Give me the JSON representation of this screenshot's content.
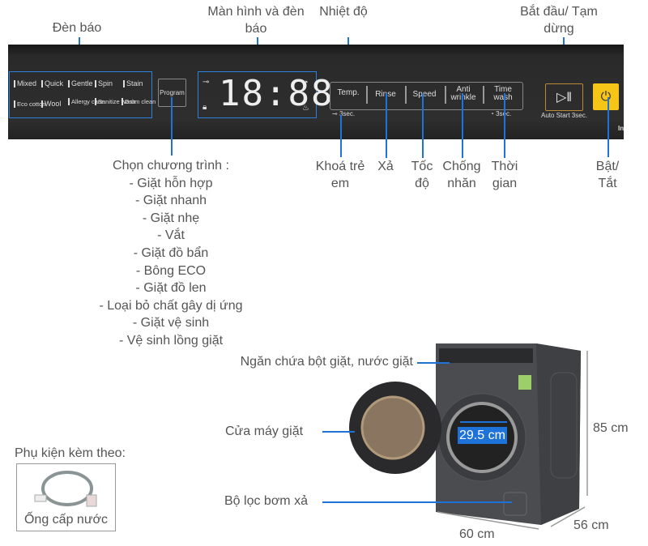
{
  "callouts_top": {
    "indicator": "Đèn báo",
    "display": "Màn hình và đèn báo",
    "temperature": "Nhiệt độ",
    "start_pause": "Bắt đầu/ Tạm dừng"
  },
  "panel": {
    "programs_row1": [
      "Mixed",
      "Quick",
      "Gentle",
      "Spin",
      "Stain"
    ],
    "programs_row2": [
      "Eco cotton",
      "Wool",
      "Allergy care",
      "Sanitize wash",
      "Drum clean"
    ],
    "program_button": "Program",
    "display_digits": "18:88",
    "buttons": [
      "Temp.",
      "Rinse",
      "Speed",
      "Anti wrinkle",
      "Time wash"
    ],
    "lock_hint": "3sec.",
    "timer_hint": "3sec.",
    "auto_start": "Auto Start 3sec.",
    "partial_text": "In",
    "power_color": "#f5c518"
  },
  "callouts_bottom": {
    "child_lock": "Khoá trẻ em",
    "rinse": "Xả",
    "speed": "Tốc độ",
    "anti_wrinkle": "Chống nhăn",
    "time": "Thời gian",
    "power": "Bật/ Tắt"
  },
  "program_list": {
    "title": "Chọn chương trình :",
    "items": [
      "- Giặt hỗn hợp",
      "- Giặt nhanh",
      "- Giặt nhẹ",
      "- Vắt",
      "- Giặt đồ bẩn",
      "- Bông ECO",
      "- Giặt đồ len",
      "- Loại bỏ chất gây dị ứng",
      "- Giặt vệ sinh",
      "- Vệ sinh lồng giặt"
    ]
  },
  "machine": {
    "detergent": "Ngăn chứa bột giặt, nước giặt",
    "door": "Cửa máy giặt",
    "filter": "Bộ lọc bơm xả",
    "door_diameter": "29.5 cm",
    "height": "85 cm",
    "depth": "56 cm",
    "width": "60 cm"
  },
  "accessories": {
    "title": "Phụ kiện kèm theo:",
    "item": "Ống cấp nước"
  },
  "colors": {
    "accent": "#1e73d8",
    "text": "#555555"
  }
}
